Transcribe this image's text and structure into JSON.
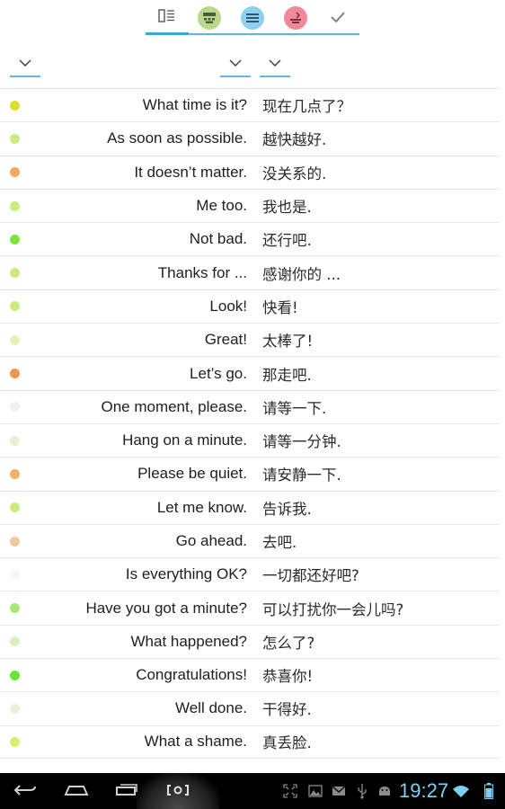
{
  "tabs": [
    {
      "name": "tab-list",
      "icon": "list-book-icon",
      "active": true
    },
    {
      "name": "tab-quiz",
      "icon": "keypad-icon",
      "color": "#b8d98a"
    },
    {
      "name": "tab-lines",
      "icon": "lines-icon",
      "color": "#8ed0ee"
    },
    {
      "name": "tab-speak",
      "icon": "speak-icon",
      "color": "#f08a98"
    },
    {
      "name": "tab-done",
      "icon": "check-icon"
    }
  ],
  "filters": [
    {
      "name": "filter-dropdown-1",
      "icon": "chevron-down-icon"
    },
    {
      "name": "filter-dropdown-2",
      "icon": "chevron-down-icon"
    },
    {
      "name": "filter-dropdown-3",
      "icon": "chevron-down-icon"
    }
  ],
  "phrases": [
    {
      "en": "What time is it?",
      "zh": "现在几点了？",
      "status": "#dde02a"
    },
    {
      "en": "As soon as possible.",
      "zh": "越快越好.",
      "status": "#c8ec80"
    },
    {
      "en": "It doesn’t matter.",
      "zh": "没关系的.",
      "status": "#f0a860"
    },
    {
      "en": "Me too.",
      "zh": "我也是.",
      "status": "#c8ec80"
    },
    {
      "en": "Not bad.",
      "zh": "还行吧.",
      "status": "#7ee43a"
    },
    {
      "en": "Thanks for ...",
      "zh": "感谢你的 ...",
      "status": "#c8ec80"
    },
    {
      "en": "Look!",
      "zh": "快看!",
      "status": "#c8ec80"
    },
    {
      "en": "Great!",
      "zh": "太棒了!",
      "status": "#e4f0b8"
    },
    {
      "en": "Let’s go.",
      "zh": "那走吧.",
      "status": "#ec9a48"
    },
    {
      "en": "One moment, please.",
      "zh": "请等一下.",
      "status": "#f2f2ec"
    },
    {
      "en": "Hang on a minute.",
      "zh": "请等一分钟.",
      "status": "#e4f2d0"
    },
    {
      "en": "Please be quiet.",
      "zh": "请安静一下.",
      "status": "#f0b070"
    },
    {
      "en": "Let me know.",
      "zh": "告诉我.",
      "status": "#c8ec80"
    },
    {
      "en": "Go ahead.",
      "zh": "去吧.",
      "status": "#f0c8a0"
    },
    {
      "en": "Is everything OK?",
      "zh": "一切都还好吧?",
      "status": "#f6f6f6"
    },
    {
      "en": "Have you got a minute?",
      "zh": "可以打扰你一会儿吗?",
      "status": "#a8e878"
    },
    {
      "en": "What happened?",
      "zh": "怎么了?",
      "status": "#d8f0c0"
    },
    {
      "en": "Congratulations!",
      "zh": "恭喜你!",
      "status": "#6ee03a"
    },
    {
      "en": "Well done.",
      "zh": "干得好.",
      "status": "#e8f4d8"
    },
    {
      "en": "What a shame.",
      "zh": "真丢脸.",
      "status": "#d8ec70"
    }
  ],
  "navbar": {
    "clock": "19:27",
    "buttons": [
      "back-icon",
      "home-icon",
      "recents-icon",
      "screenshot-icon"
    ],
    "status_icons": [
      "fullscreen-icon",
      "gallery-icon",
      "mail-icon",
      "usb-icon",
      "android-debug-icon",
      "wifi-icon",
      "battery-icon"
    ]
  }
}
